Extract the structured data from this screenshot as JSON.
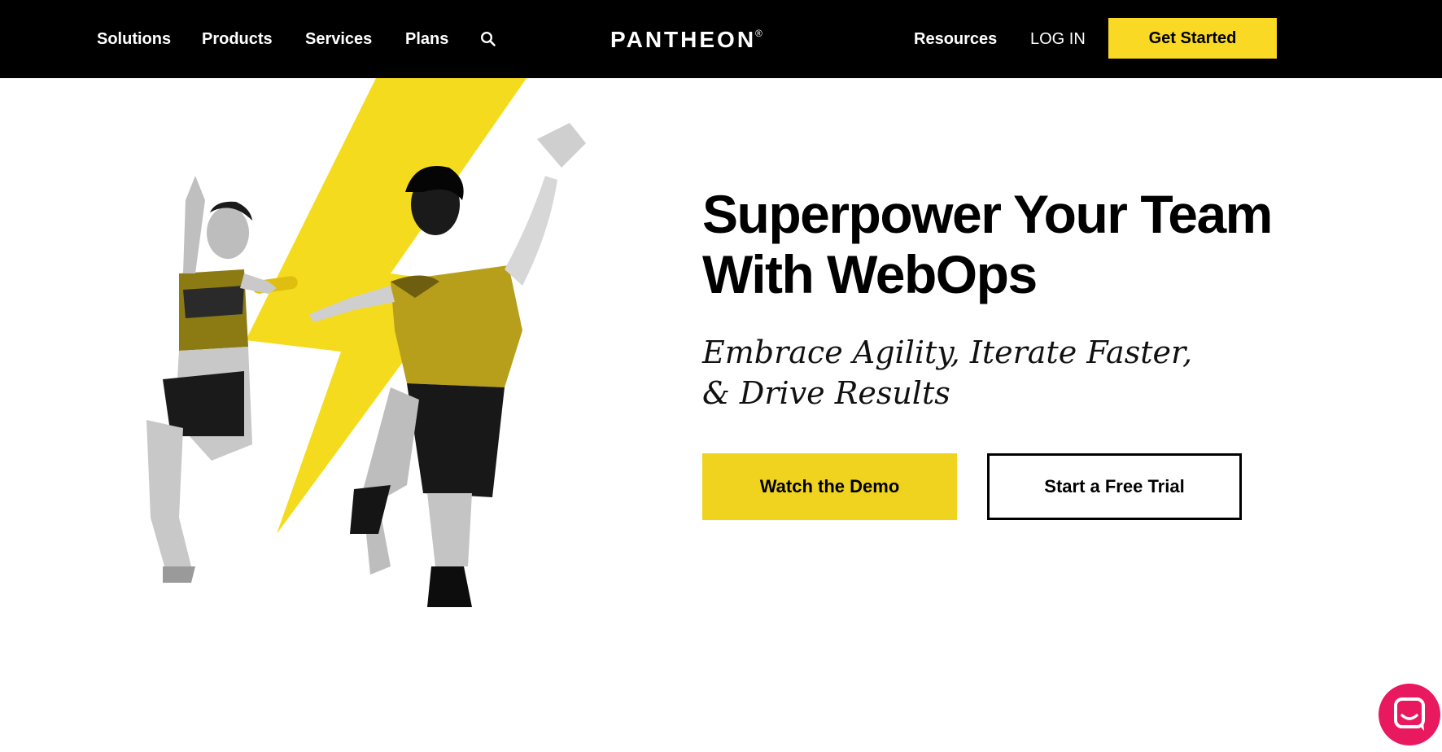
{
  "nav": {
    "left_links": [
      "Solutions",
      "Products",
      "Services",
      "Plans"
    ],
    "logo": "PANTHEON",
    "logo_mark": "®",
    "resources": "Resources",
    "login": "LOG IN",
    "cta": "Get Started"
  },
  "hero": {
    "headline_line1": "Superpower Your Team",
    "headline_line2": "With WebOps",
    "subhead_line1": "Embrace Agility, Iterate Faster,",
    "subhead_line2": "& Drive Results",
    "primary_button": "Watch the Demo",
    "secondary_button": "Start a Free Trial"
  },
  "icons": {
    "search": "search-icon",
    "chat": "chat-bubble-icon"
  },
  "colors": {
    "nav_background": "#000000",
    "accent_yellow": "#f9d923",
    "demo_button": "#efd31f",
    "chat_pink": "#e9195f",
    "text": "#000000"
  }
}
